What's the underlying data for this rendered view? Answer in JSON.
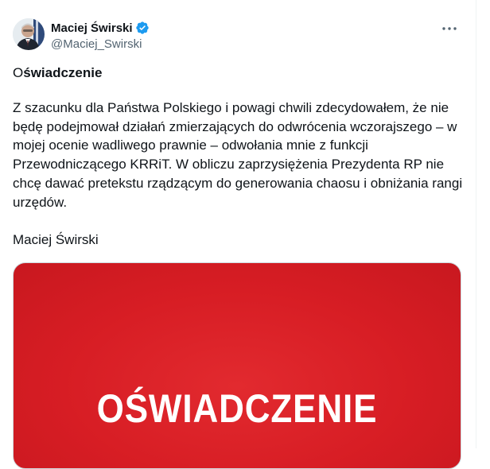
{
  "author": {
    "display_name": "Maciej Świrski",
    "handle": "@Maciej_Swirski",
    "verified_icon": "verified-badge-icon",
    "avatar_icon": "profile-photo"
  },
  "more_menu_icon": "more-horizontal-icon",
  "tweet": {
    "title_first_char": "O",
    "title_rest": "świadczenie",
    "body": "Z szacunku dla Państwa Polskiego i powagi chwili zdecydowałem, że nie będę podejmował działań zmierzających do odwrócenia wczorajszego – w mojej ocenie wadliwego prawnie – odwołania mnie z funkcji Przewodniczącego KRRiT. W obliczu zaprzysiężenia Prezydenta RP nie chcę dawać pretekstu rządzącym do generowania chaosu i obniżania rangi urzędów.",
    "signature": "Maciej Świrski"
  },
  "media": {
    "text": "OŚWIADCZENIE",
    "background_color": "#d71d24"
  },
  "colors": {
    "accent": "#1d9bf0",
    "text_primary": "#0f1419",
    "text_secondary": "#536471"
  }
}
